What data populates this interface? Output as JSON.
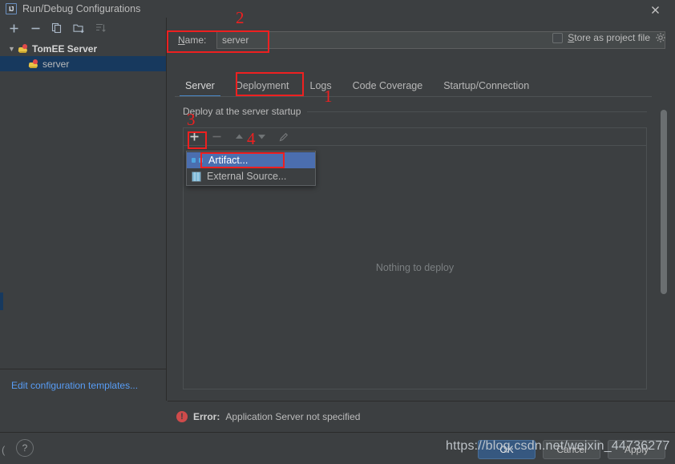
{
  "window": {
    "title": "Run/Debug Configurations",
    "app_icon": "intellij-idea-icon",
    "close_icon": "close-icon"
  },
  "left_panel": {
    "toolbar": [
      {
        "name": "add-configuration-button",
        "icon": "plus-icon",
        "label": "+"
      },
      {
        "name": "remove-configuration-button",
        "icon": "minus-icon",
        "label": "−"
      },
      {
        "name": "copy-configuration-button",
        "icon": "copy-icon",
        "label": "Copy"
      },
      {
        "name": "save-configuration-button",
        "icon": "folder-save-icon",
        "label": "Save"
      },
      {
        "name": "sort-configurations-button",
        "icon": "sort-icon",
        "label": "Sort"
      }
    ],
    "tree": [
      {
        "label": "TomEE Server",
        "icon": "tomee-icon",
        "expanded": true,
        "selected": false,
        "level": 0
      },
      {
        "label": "server",
        "icon": "tomee-icon",
        "expanded": false,
        "selected": true,
        "level": 1
      }
    ],
    "footer_link": "Edit configuration templates..."
  },
  "main": {
    "name_label": "Name:",
    "name_mnemonic": "N",
    "name_value": "server",
    "name_placeholder": "",
    "store_as_project_file": {
      "label": "Store as project file",
      "mnemonic": "S",
      "checked": false,
      "gear_icon": "gear-icon"
    },
    "tabs": [
      {
        "label": "Server",
        "active": true
      },
      {
        "label": "Deployment",
        "active": false
      },
      {
        "label": "Logs",
        "active": false
      },
      {
        "label": "Code Coverage",
        "active": false
      },
      {
        "label": "Startup/Connection",
        "active": false
      }
    ],
    "section_title": "Deploy at the server startup",
    "deploy_toolbar": [
      {
        "name": "add-deployment-button",
        "icon": "plus-icon",
        "label": "+",
        "enabled": true
      },
      {
        "name": "remove-deployment-button",
        "icon": "minus-icon",
        "label": "−",
        "enabled": false
      },
      {
        "name": "move-up-button",
        "icon": "arrow-up-icon",
        "label": "▲",
        "enabled": false
      },
      {
        "name": "move-down-button",
        "icon": "arrow-down-icon",
        "label": "▼",
        "enabled": false
      },
      {
        "name": "edit-deployment-button",
        "icon": "pencil-icon",
        "label": "✎",
        "enabled": false
      }
    ],
    "empty_list_text": "Nothing to deploy"
  },
  "popup_menu": {
    "visible": true,
    "items": [
      {
        "label": "Artifact...",
        "icon": "artifact-icon",
        "selected": true
      },
      {
        "label": "External Source...",
        "icon": "external-source-icon",
        "selected": false
      }
    ]
  },
  "error_bar": {
    "icon": "error-icon",
    "prefix": "Error:",
    "message": "Application Server not specified"
  },
  "bottom_bar": {
    "help_label": "?",
    "buttons": [
      {
        "label": "OK",
        "primary": true
      },
      {
        "label": "Cancel",
        "primary": false
      },
      {
        "label": "Apply",
        "primary": false
      }
    ]
  },
  "watermark": "https://blog.csdn.net/weixin_44736277",
  "annotations": [
    {
      "number": "1",
      "target": "deployment-tab"
    },
    {
      "number": "2",
      "target": "name-field"
    },
    {
      "number": "3",
      "target": "add-deployment-button"
    },
    {
      "number": "4",
      "target": "artifact-menu-item"
    }
  ],
  "colors": {
    "background": "#3c3f41",
    "selection_blue": "#4b6eaf",
    "tree_selection": "#17395e",
    "accent_tab": "#4a88c7",
    "link": "#589df6",
    "error_red": "#cf4b4b",
    "annotation_red": "#ee2020",
    "primary_button": "#365880"
  }
}
